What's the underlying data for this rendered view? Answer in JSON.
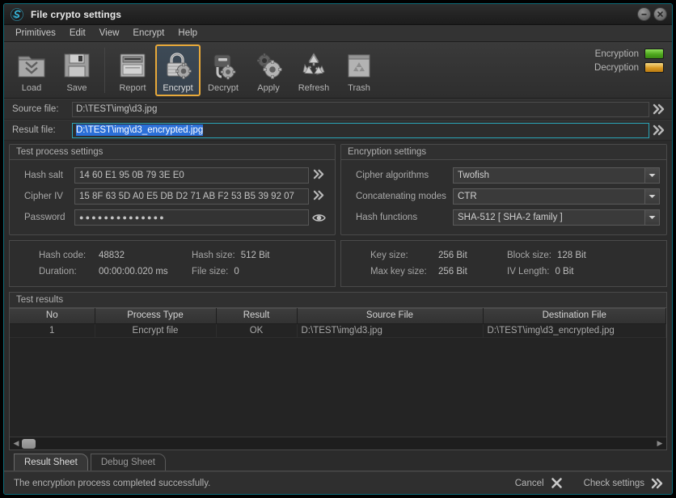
{
  "window": {
    "title": "File crypto settings",
    "logo_icon": "app-logo-s-icon",
    "minimize_label": "–",
    "close_label": "✕"
  },
  "menu": {
    "items": [
      {
        "label": "Primitives"
      },
      {
        "label": "Edit"
      },
      {
        "label": "View"
      },
      {
        "label": "Encrypt"
      },
      {
        "label": "Help"
      }
    ]
  },
  "toolbar": {
    "buttons": [
      {
        "label": "Load",
        "icon": "folder-down-icon",
        "active": false
      },
      {
        "label": "Save",
        "icon": "floppy-disk-icon",
        "active": false
      },
      {
        "label": "Report",
        "icon": "report-icon",
        "active": false
      },
      {
        "label": "Encrypt",
        "icon": "padlock-gear-icon",
        "active": true
      },
      {
        "label": "Decrypt",
        "icon": "unlock-gear-icon",
        "active": false
      },
      {
        "label": "Apply",
        "icon": "gears-icon",
        "active": false
      },
      {
        "label": "Refresh",
        "icon": "recycle-icon",
        "active": false
      },
      {
        "label": "Trash",
        "icon": "trash-recycle-icon",
        "active": false
      }
    ],
    "indicators": [
      {
        "label": "Encryption",
        "color": "#56b01f",
        "state": "green"
      },
      {
        "label": "Decryption",
        "color": "#d99a23",
        "state": "amber"
      }
    ]
  },
  "files": {
    "source": {
      "label": "Source file:",
      "value": "D:\\TEST\\img\\d3.jpg",
      "browse_icon": "double-chevron-icon"
    },
    "result": {
      "label": "Result file:",
      "value": "D:\\TEST\\img\\d3_encrypted.jpg",
      "selected": true,
      "browse_icon": "double-chevron-icon"
    }
  },
  "test_process": {
    "title": "Test process settings",
    "fields": [
      {
        "label": "Hash salt",
        "value": "14 60 E1 95 0B 79 3E E0",
        "action_icon": "double-chevron-icon"
      },
      {
        "label": "Cipher IV",
        "value": "15 8F 63 5D A0 E5 DB D2 71 AB F2 53 B5 39 92 07",
        "action_icon": "double-chevron-icon"
      },
      {
        "label": "Password",
        "value": "●●●●●●●●●●●●●●",
        "action_icon": "eye-icon"
      }
    ],
    "stats": [
      {
        "k1": "Hash code:",
        "v1": "48832",
        "k2": "Hash size:",
        "v2": "512 Bit"
      },
      {
        "k1": "Duration:",
        "v1": "00:00:00.020 ms",
        "k2": "File size:",
        "v2": "0"
      }
    ]
  },
  "encryption_settings": {
    "title": "Encryption settings",
    "fields": [
      {
        "label": "Cipher algorithms",
        "value": "Twofish"
      },
      {
        "label": "Concatenating modes",
        "value": "CTR"
      },
      {
        "label": "Hash functions",
        "value": "SHA-512 [ SHA-2 family ]"
      }
    ],
    "stats": [
      {
        "k1": "Key size:",
        "v1": "256 Bit",
        "k2": "Block size:",
        "v2": "128 Bit"
      },
      {
        "k1": "Max key size:",
        "v1": "256 Bit",
        "k2": "IV Length:",
        "v2": "0 Bit"
      }
    ]
  },
  "results": {
    "title": "Test results",
    "columns": [
      "No",
      "Process Type",
      "Result",
      "Source File",
      "Destination File"
    ],
    "rows": [
      {
        "no": "1",
        "process_type": "Encrypt file",
        "result": "OK",
        "source_file": "D:\\TEST\\img\\d3.jpg",
        "destination_file": "D:\\TEST\\img\\d3_encrypted.jpg"
      }
    ],
    "scroll_left_icon": "caret-left-icon",
    "scroll_right_icon": "caret-right-icon"
  },
  "tabs": [
    {
      "label": "Result Sheet",
      "active": true
    },
    {
      "label": "Debug Sheet",
      "active": false
    }
  ],
  "statusbar": {
    "message": "The encryption process completed successfully.",
    "cancel_label": "Cancel",
    "cancel_icon": "x-mark-icon",
    "check_label": "Check settings",
    "check_icon": "double-chevron-icon"
  }
}
